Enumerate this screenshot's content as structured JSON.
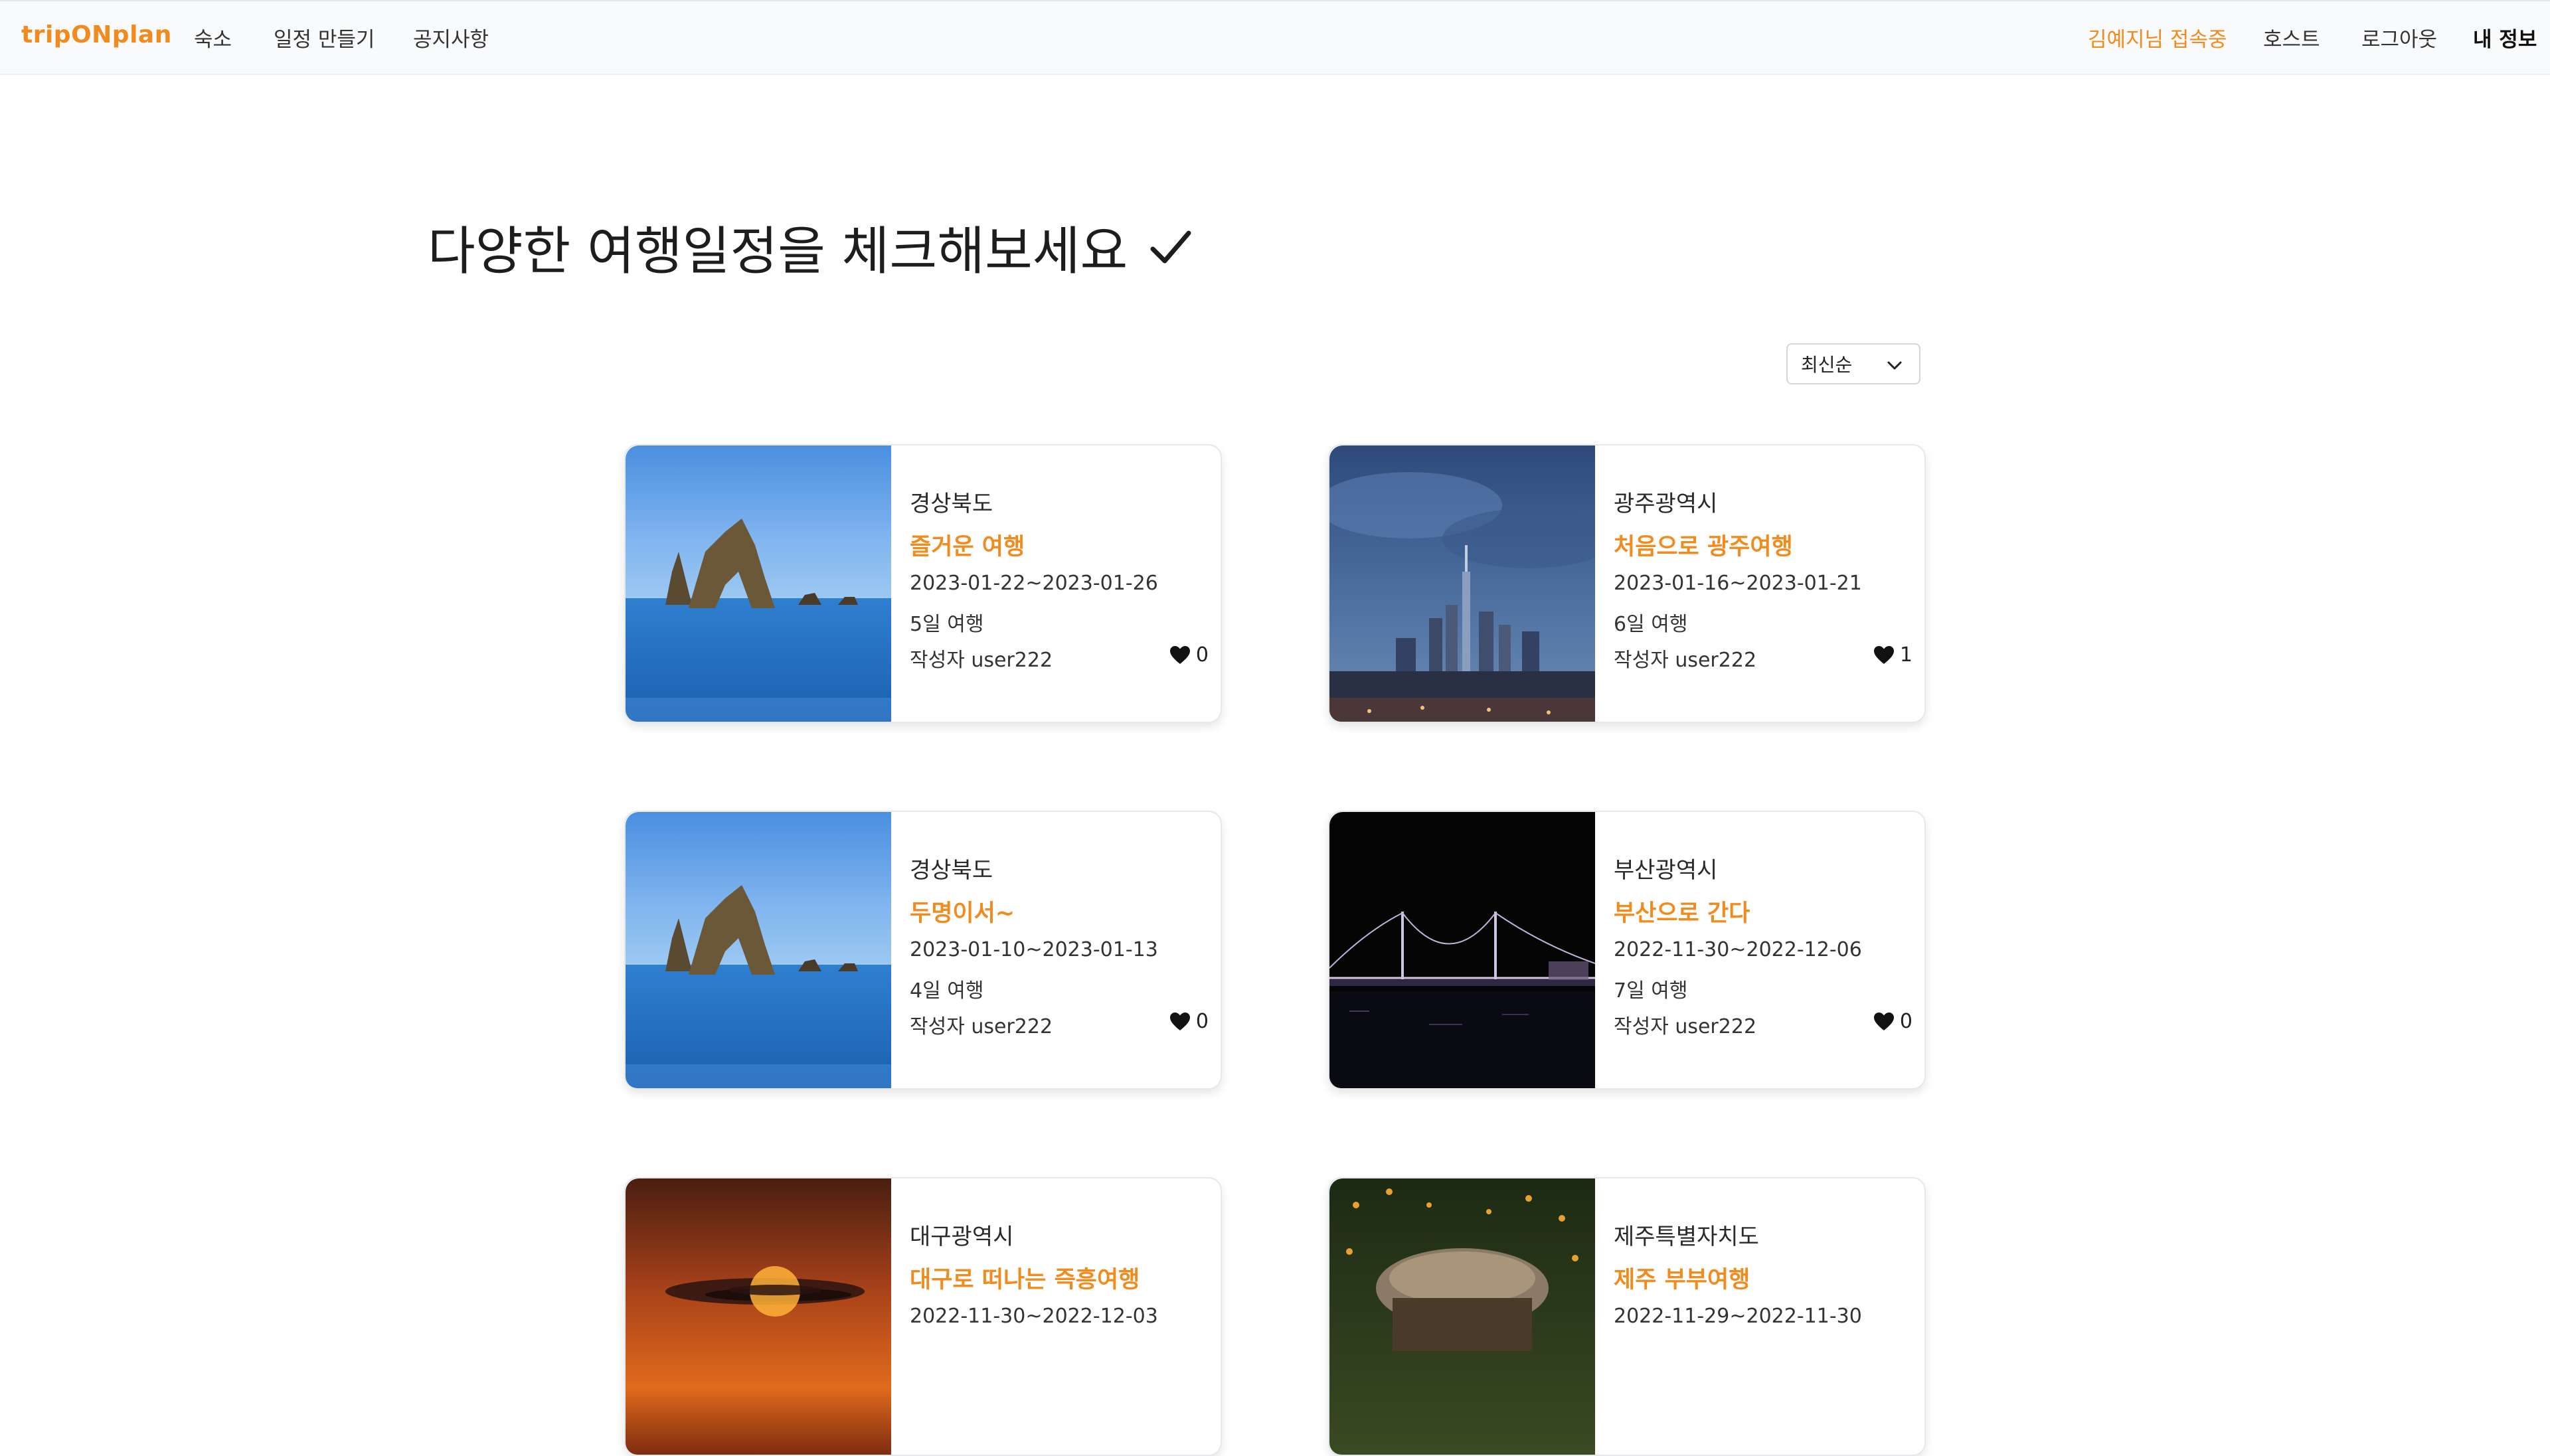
{
  "nav": {
    "brand": "tripONplan",
    "links": [
      "숙소",
      "일정 만들기",
      "공지사항"
    ],
    "user_status": "김예지님 접속중",
    "host": "호스트",
    "logout": "로그아웃",
    "myinfo": "내 정보"
  },
  "heading": {
    "title": "다양한 여행일정을 체크해보세요"
  },
  "sort": {
    "selected": "최신순"
  },
  "icons": {
    "check": "check-icon",
    "chevron": "chevron-down-icon",
    "heart": "heart-icon"
  },
  "colors": {
    "accent": "#f28b1e",
    "navbar_bg": "#f8fafc"
  },
  "trips": [
    {
      "region": "경상북도",
      "title": "즐거운 여행",
      "dates": "2023-01-22~2023-01-26",
      "days": "5일 여행",
      "author": "작성자 user222",
      "likes": "0",
      "image": "sea-rocks-photo"
    },
    {
      "region": "광주광역시",
      "title": "처음으로 광주여행",
      "dates": "2023-01-16~2023-01-21",
      "days": "6일 여행",
      "author": "작성자 user222",
      "likes": "1",
      "image": "city-skyline-photo"
    },
    {
      "region": "경상북도",
      "title": "두명이서~",
      "dates": "2023-01-10~2023-01-13",
      "days": "4일 여행",
      "author": "작성자 user222",
      "likes": "0",
      "image": "sea-rocks-photo"
    },
    {
      "region": "부산광역시",
      "title": "부산으로 간다",
      "dates": "2022-11-30~2022-12-06",
      "days": "7일 여행",
      "author": "작성자 user222",
      "likes": "0",
      "image": "night-bridge-photo"
    },
    {
      "region": "대구광역시",
      "title": "대구로 떠나는 즉흥여행",
      "dates": "2022-11-30~2022-12-03",
      "image": "sunset-photo"
    },
    {
      "region": "제주특별자치도",
      "title": "제주 부부여행",
      "dates": "2022-11-29~2022-11-30",
      "image": "jeju-hut-photo"
    }
  ]
}
